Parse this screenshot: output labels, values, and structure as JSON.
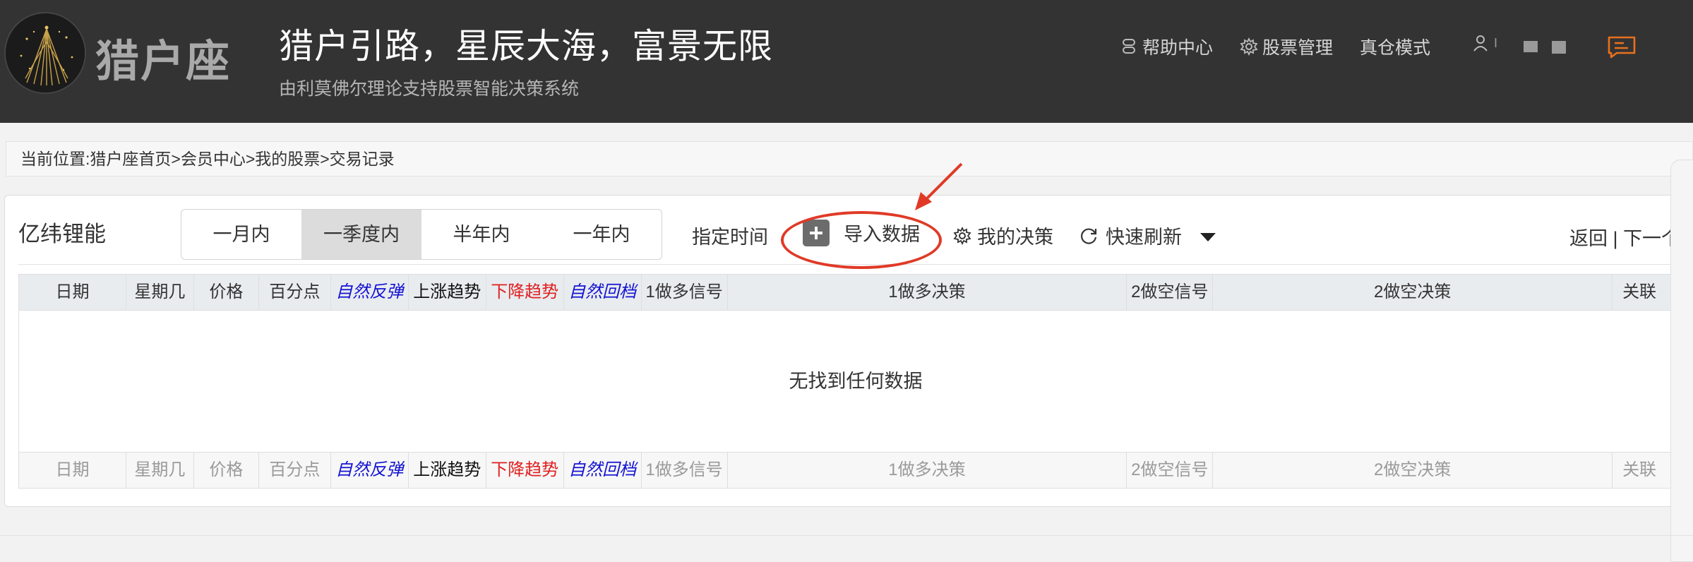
{
  "header": {
    "logo_text": "猎户座",
    "slogan": "猎户引路，星辰大海，富景无限",
    "subtitle": "由利莫佛尔理论支持股票智能决策系统",
    "nav": {
      "help": "帮助中心",
      "stock_manage": "股票管理",
      "real_mode": "真仓模式"
    },
    "user_label": "I"
  },
  "breadcrumb": "当前位置:猎户座首页>会员中心>我的股票>交易记录",
  "toolbar": {
    "stock_name": "亿纬锂能",
    "periods": [
      "一月内",
      "一季度内",
      "半年内",
      "一年内"
    ],
    "active_period": "一季度内",
    "custom_time": "指定时间",
    "import_data": "导入数据",
    "my_decision": "我的决策",
    "quick_refresh": "快速刷新",
    "back_next": "返回 | 下一个"
  },
  "table": {
    "columns": [
      "日期",
      "星期几",
      "价格",
      "百分点",
      "自然反弹",
      "上涨趋势",
      "下降趋势",
      "自然回档",
      "1做多信号",
      "1做多决策",
      "2做空信号",
      "2做空决策",
      "关联"
    ],
    "empty_message": "无找到任何数据"
  },
  "colors": {
    "header_bg": "#333333",
    "accent_orange": "#e8701e",
    "annotation_red": "#e03a26",
    "blue_col": "#1414d2",
    "red_col": "#e02020"
  }
}
